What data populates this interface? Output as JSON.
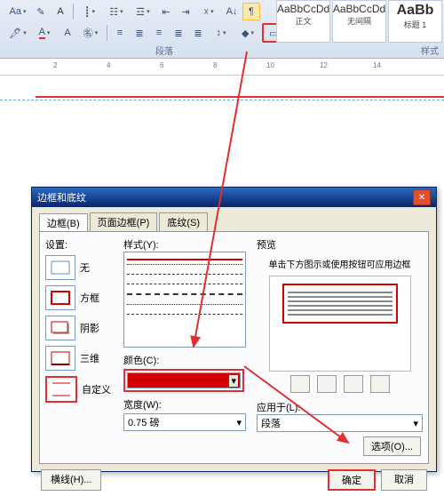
{
  "ribbon": {
    "styles": [
      {
        "sample": "AaBbCcDd",
        "name": "正文"
      },
      {
        "sample": "AaBbCcDd",
        "name": "无间隔"
      },
      {
        "sample": "AaBb",
        "name": "标题 1"
      }
    ],
    "group_paragraph": "段落",
    "group_styles": "样式"
  },
  "ruler": {
    "marks": [
      "2",
      "4",
      "6",
      "8",
      "10",
      "12",
      "14"
    ]
  },
  "dialog": {
    "title": "边框和底纹",
    "tabs": [
      "边框(B)",
      "页面边框(P)",
      "底纹(S)"
    ],
    "settings_label": "设置:",
    "settings": [
      "无",
      "方框",
      "阴影",
      "三维",
      "自定义"
    ],
    "style_label": "样式(Y):",
    "color_label": "颜色(C):",
    "color_value": "#d20000",
    "width_label": "宽度(W):",
    "width_value": "0.75 磅",
    "preview_label": "预览",
    "preview_hint": "单击下方图示或使用按钮可应用边框",
    "apply_to_label": "应用于(L):",
    "apply_to_value": "段落",
    "options_btn": "选项(O)...",
    "hline_btn": "横线(H)...",
    "ok": "确定",
    "cancel": "取消"
  }
}
